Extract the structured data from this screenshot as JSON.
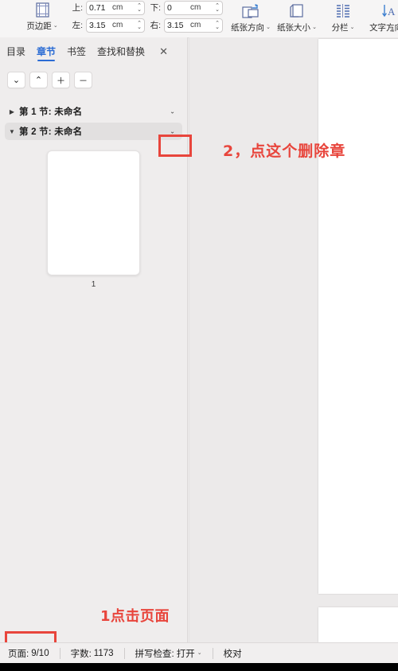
{
  "ribbon": {
    "page_setup_icon": "page-margins-icon",
    "margins_label": "页边距",
    "fields": [
      {
        "label": "上:",
        "value": "0.71",
        "unit": "cm",
        "name": "margin-top"
      },
      {
        "label": "下:",
        "value": "0",
        "unit": "cm",
        "name": "margin-bottom"
      },
      {
        "label": "左:",
        "value": "3.15",
        "unit": "cm",
        "name": "margin-left"
      },
      {
        "label": "右:",
        "value": "3.15",
        "unit": "cm",
        "name": "margin-right"
      }
    ],
    "buttons": [
      {
        "label": "纸张方向",
        "icon": "page-orientation-icon",
        "caret": "⌄"
      },
      {
        "label": "纸张大小",
        "icon": "paper-size-icon",
        "caret": "⌄"
      },
      {
        "label": "分栏",
        "icon": "columns-icon",
        "caret": "⌄"
      },
      {
        "label": "文字方向",
        "icon": "text-direction-icon",
        "caret": "⌄"
      }
    ],
    "expand_glyph": "↘"
  },
  "nav": {
    "tabs": [
      {
        "label": "目录",
        "active": false
      },
      {
        "label": "章节",
        "active": true
      },
      {
        "label": "书签",
        "active": false
      },
      {
        "label": "查找和替换",
        "active": false
      }
    ],
    "close_glyph": "✕",
    "toolbar": [
      {
        "name": "move-down-button",
        "glyph": "⌄"
      },
      {
        "name": "move-up-button",
        "glyph": "⌃"
      },
      {
        "name": "add-section-button",
        "glyph": "＋"
      },
      {
        "name": "remove-section-button",
        "glyph": "－"
      }
    ],
    "sections": [
      {
        "label": "第 1 节: 未命名",
        "expanded": false,
        "arrow": "▶",
        "chevron": "⌄",
        "selected": false
      },
      {
        "label": "第 2 节: 未命名",
        "expanded": true,
        "arrow": "▼",
        "chevron": "⌄",
        "selected": true
      }
    ],
    "thumbnail_number": "1"
  },
  "annotations": [
    {
      "name": "annotation-delete-section",
      "text": "2，点这个删除章"
    },
    {
      "name": "annotation-click-page",
      "text": "1点击页面"
    }
  ],
  "status": {
    "page_label": "页面:",
    "page_value": "9/10",
    "words_label": "字数:",
    "words_value": "1173",
    "spellcheck_label": "拼写检查:",
    "spellcheck_value": "打开",
    "spellcheck_caret": "⌄",
    "proofread_label": "校对"
  },
  "colors": {
    "accent": "#2b6cd4",
    "annotation_red": "#e8453c",
    "panel_bg": "#efeded",
    "workspace_bg": "#eceaea"
  }
}
